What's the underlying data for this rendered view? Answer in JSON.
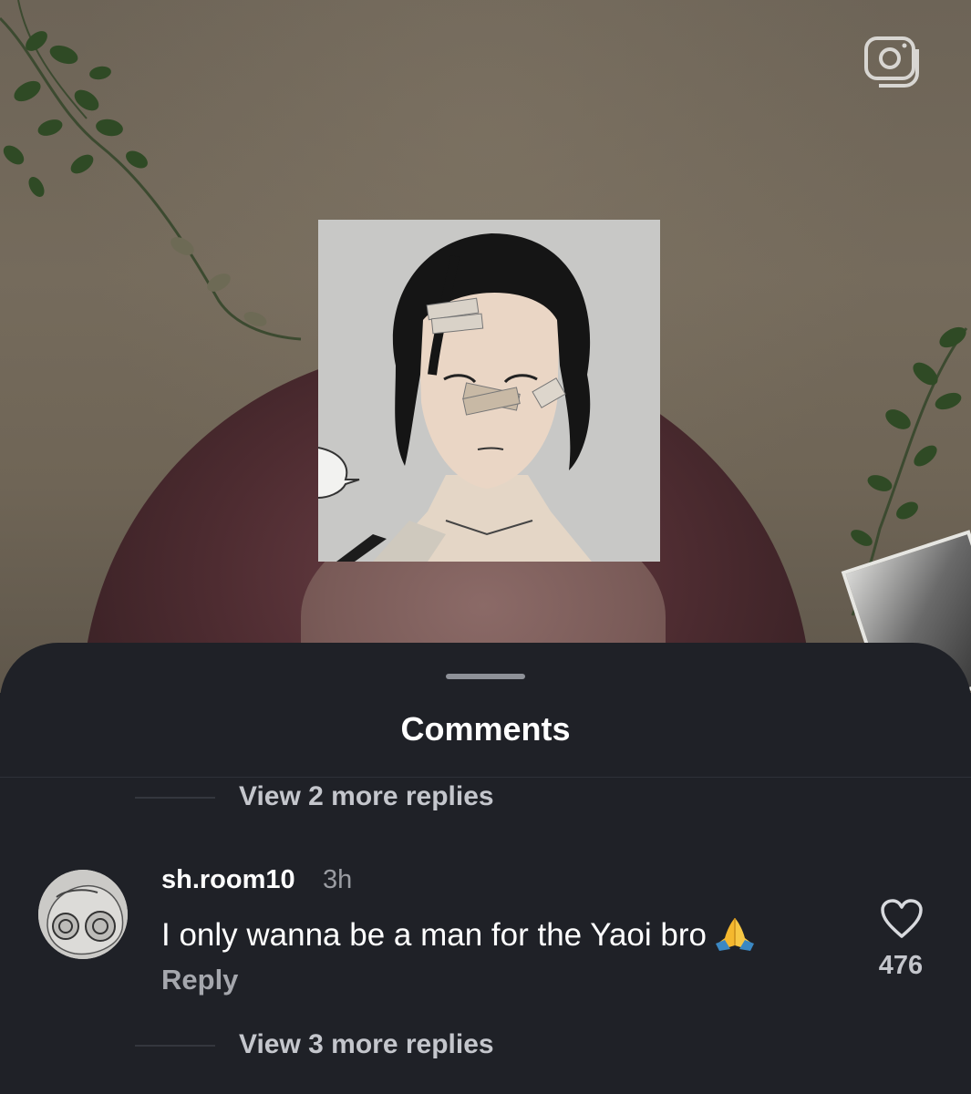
{
  "sheet": {
    "title": "Comments"
  },
  "thread_top": {
    "view_replies_label": "View 2 more replies"
  },
  "comment": {
    "username": "sh.room10",
    "timestamp": "3h",
    "text": "I only wanna be a man for the Yaoi bro",
    "emoji": "folded-hands-emoji",
    "reply_label": "Reply",
    "like_count": "476"
  },
  "thread_bottom": {
    "view_replies_label": "View 3 more replies"
  },
  "icons": {
    "top_right": "camera-icon",
    "like": "heart-icon"
  },
  "colors": {
    "sheet_background": "#1f2127",
    "primary_text": "#ffffff",
    "secondary_text": "#c4c6cc"
  }
}
